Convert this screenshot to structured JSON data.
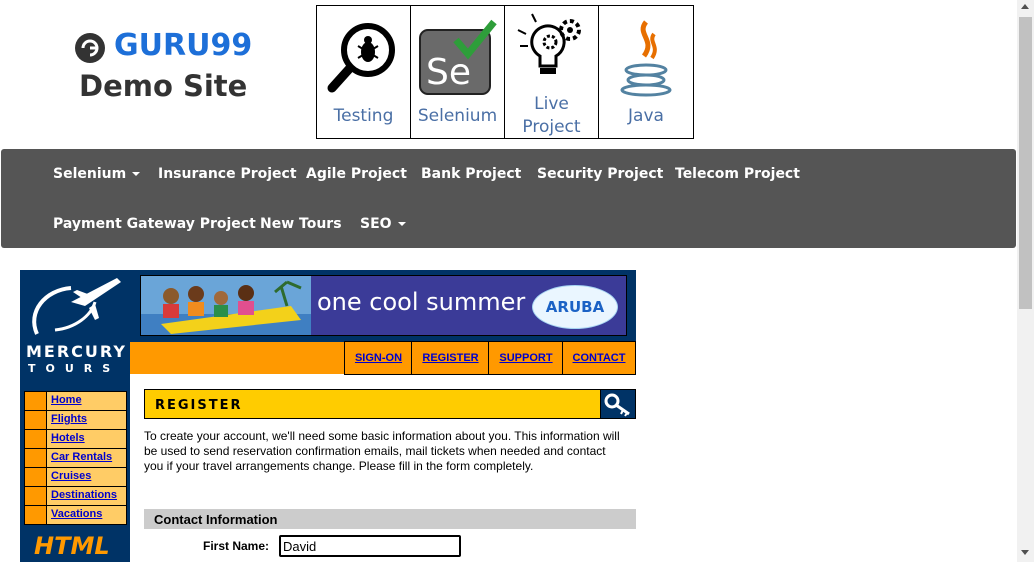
{
  "header": {
    "logo_text": "GURU99",
    "logo_sub": "Demo Site",
    "tiles": [
      {
        "label": "Testing",
        "icon": "magnifier-bug-icon"
      },
      {
        "label": "Selenium",
        "icon": "selenium-check-icon"
      },
      {
        "label_line1": "Live",
        "label_line2": "Project",
        "icon": "lightbulb-gears-icon"
      },
      {
        "label": "Java",
        "icon": "java-cup-icon"
      }
    ]
  },
  "nav": {
    "items": [
      {
        "label": "Selenium",
        "dropdown": true
      },
      {
        "label": "Insurance Project"
      },
      {
        "label": "Agile Project"
      },
      {
        "label": "Bank Project"
      },
      {
        "label": "Security Project"
      },
      {
        "label": "Telecom Project"
      },
      {
        "label": "Payment Gateway Project"
      },
      {
        "label": "New Tours"
      },
      {
        "label": "SEO",
        "dropdown": true
      }
    ]
  },
  "mercury": {
    "title": "MERCURY",
    "subtitle": "TOURS",
    "menu": [
      "Home",
      "Flights",
      "Hotels",
      "Car Rentals",
      "Cruises",
      "Destinations",
      "Vacations"
    ],
    "badge": "HTML"
  },
  "banner": {
    "text": "one cool summer",
    "brand": "ARUBA"
  },
  "tabs": [
    "SIGN-ON",
    "REGISTER",
    "SUPPORT",
    "CONTACT"
  ],
  "register": {
    "heading": "REGISTER",
    "intro": "To create your account, we'll need some basic information about you. This information will be used to send reservation confirmation emails, mail tickets when needed and contact you if your travel arrangements change. Please fill in the form completely.",
    "section": "Contact Information",
    "first_name_label": "First Name:",
    "first_name_value": "David"
  },
  "colors": {
    "nav_bg": "#555555",
    "mercury_blue": "#003366",
    "orange": "#ff9900",
    "yellow": "#ffcc00",
    "link": "#0000cc",
    "logo_blue": "#1d6fd8"
  }
}
